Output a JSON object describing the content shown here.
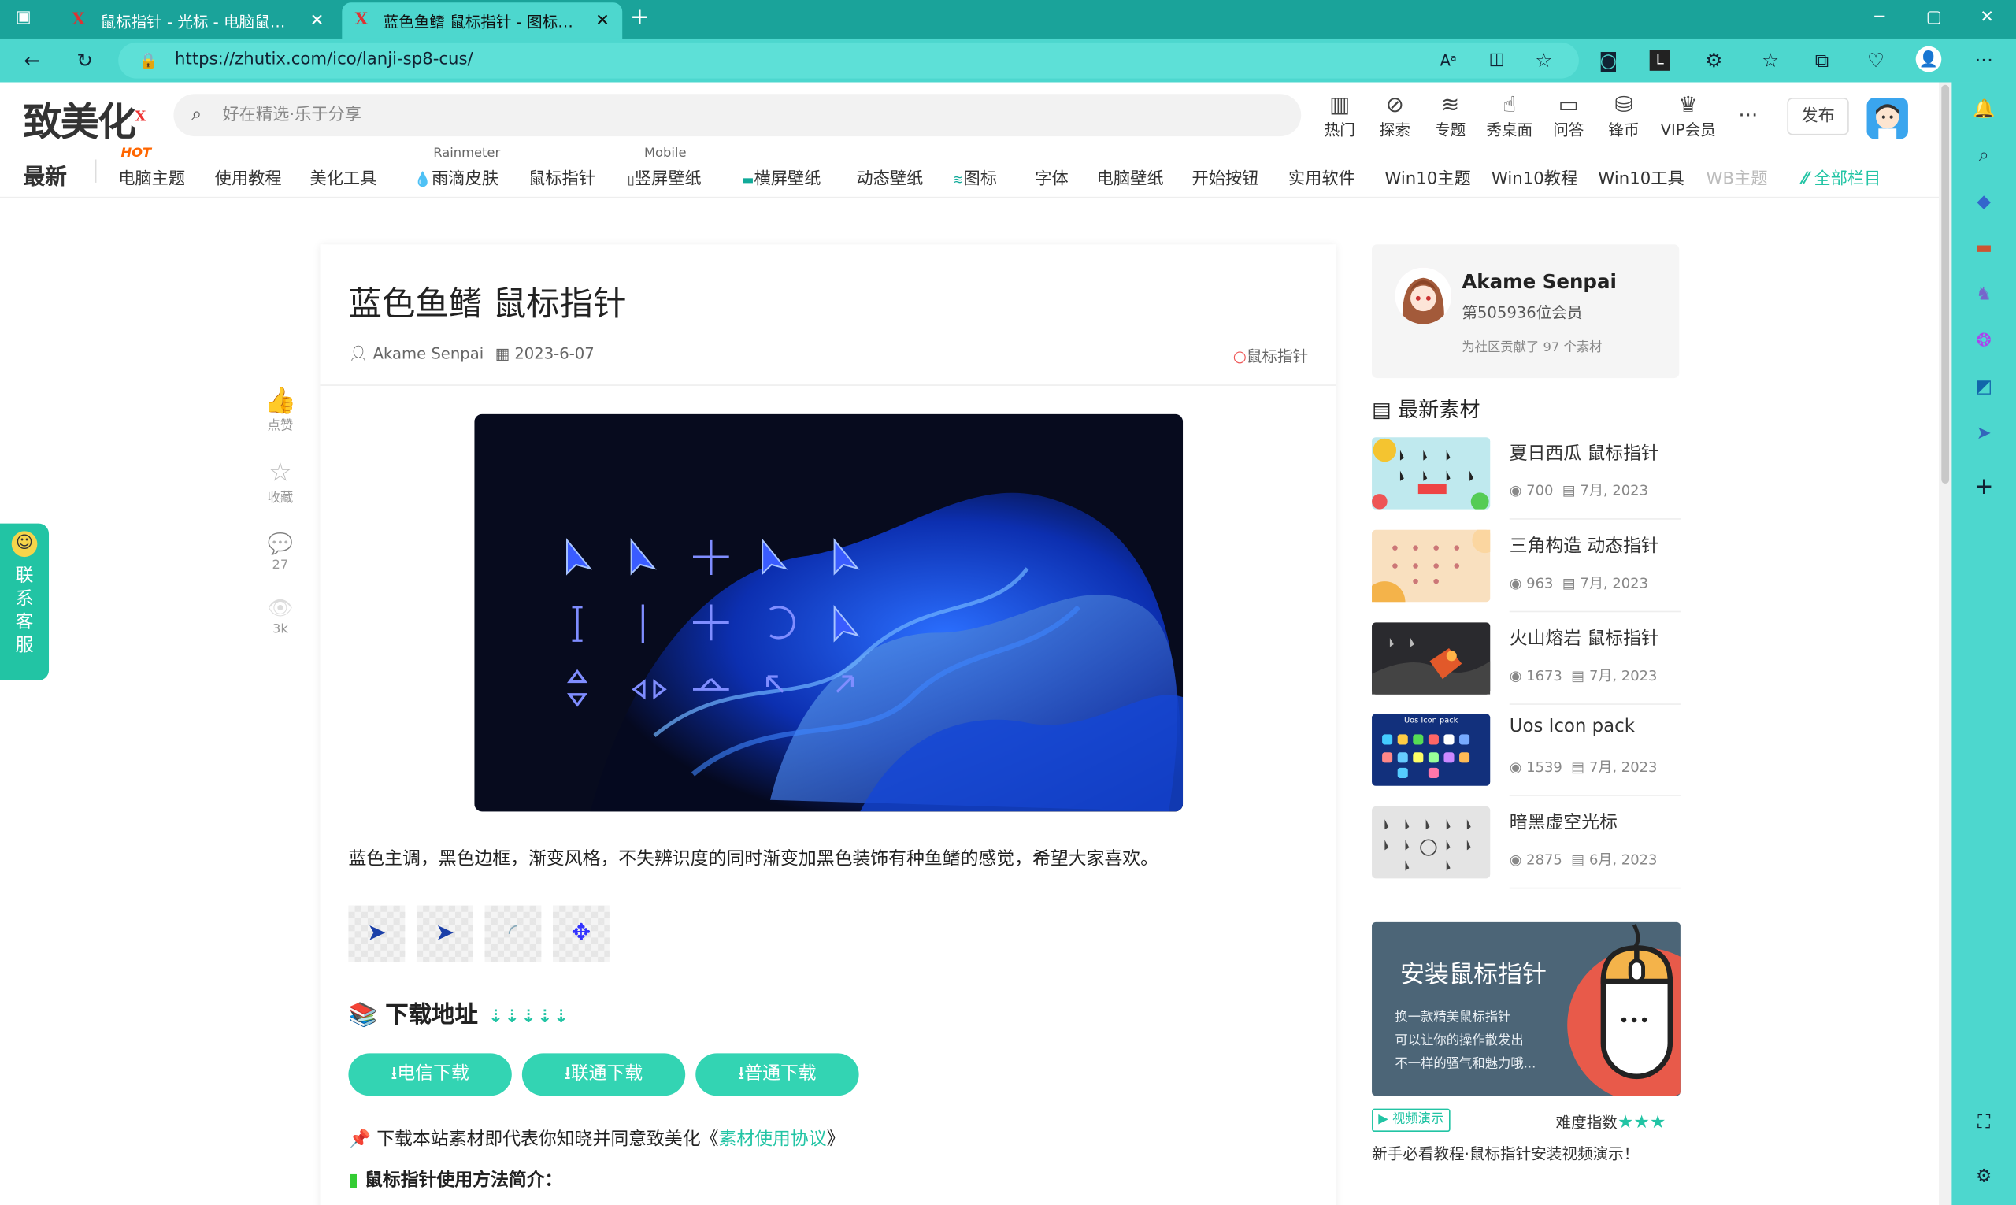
{
  "browser": {
    "tabs": [
      {
        "title": "鼠标指针 - 光标 - 电脑鼠标指针下载",
        "close": "✕",
        "active": false
      },
      {
        "title": "蓝色鱼鳍 鼠标指针 - 图标指针 - 致美化",
        "close": "✕",
        "active": true
      }
    ],
    "new_tab": "+",
    "url": "https://zhutix.com/ico/lanji-sp8-cus/",
    "win_min": "─",
    "win_max": "▢",
    "win_close": "✕"
  },
  "site": {
    "logo": "致美化",
    "logo_mark": "X",
    "search_placeholder": "好在精选·乐于分享",
    "top_nav": [
      {
        "label": "热门",
        "icon": "building-icon"
      },
      {
        "label": "探索",
        "icon": "compass-icon"
      },
      {
        "label": "专题",
        "icon": "layers-icon"
      },
      {
        "label": "秀桌面",
        "icon": "hand-icon"
      },
      {
        "label": "问答",
        "icon": "chat-icon"
      },
      {
        "label": "锋币",
        "icon": "coins-icon"
      },
      {
        "label": "VIP会员",
        "icon": "crown-icon"
      }
    ],
    "more": "···",
    "publish": "发布",
    "nav": {
      "latest": "最新",
      "hot_tag": "HOT",
      "theme": "电脑主题",
      "tutorial": "使用教程",
      "beautify": "美化工具",
      "rainmeter_small": "Rainmeter",
      "rainmeter": "雨滴皮肤",
      "cursor": "鼠标指针",
      "mobile_small": "Mobile",
      "vertical_wall": "竖屏壁纸",
      "horizontal_wall": "横屏壁纸",
      "dynamic_wall": "动态壁纸",
      "icons": "图标",
      "fonts": "字体",
      "pc_wall": "电脑壁纸",
      "start_btn": "开始按钮",
      "software": "实用软件",
      "win10_theme": "Win10主题",
      "win10_tut": "Win10教程",
      "win10_tool": "Win10工具",
      "wb_theme": "WB主题",
      "all_cols": "全部栏目"
    }
  },
  "left_actions": [
    {
      "icon": "thumbs-up-icon",
      "glyph": "👍",
      "label": "点赞"
    },
    {
      "icon": "star-icon",
      "glyph": "☆",
      "label": "收藏"
    },
    {
      "icon": "comment-icon",
      "glyph": "💬",
      "label": "27"
    },
    {
      "icon": "eye-icon",
      "glyph": "👁",
      "label": "3k"
    }
  ],
  "kefu": {
    "text": "联系客服"
  },
  "article": {
    "title": "蓝色鱼鳍 鼠标指针",
    "author": "Akame Senpai",
    "date": "2023-6-07",
    "category": "鼠标指针",
    "description": "蓝色主调，黑色边框，渐变风格，不失辨识度的同时渐变加黑色装饰有种鱼鳍的感觉，希望大家喜欢。",
    "download_title": "下载地址",
    "download_arrows": "⇣⇣⇣⇣⇣",
    "buttons": [
      "电信下载",
      "联通下载",
      "普通下载"
    ],
    "agree_prefix": "下载本站素材即代表你知晓并同意致美化《",
    "agree_link": "素材使用协议",
    "agree_suffix": "》",
    "usage_title": "鼠标指针使用方法简介："
  },
  "user": {
    "name": "Akame Senpai",
    "member": "第505936位会员",
    "contrib": "为社区贡献了 97 个素材"
  },
  "latest": {
    "title": "最新素材",
    "items": [
      {
        "title": "夏日西瓜 鼠标指针",
        "views": "700",
        "date": "7月, 2023"
      },
      {
        "title": "三角构造 动态指针",
        "views": "963",
        "date": "7月, 2023"
      },
      {
        "title": "火山熔岩 鼠标指针",
        "views": "1673",
        "date": "7月, 2023"
      },
      {
        "title": "Uos Icon pack",
        "views": "1539",
        "date": "7月, 2023",
        "thumb_text": "Uos Icon pack"
      },
      {
        "title": "暗黑虚空光标",
        "views": "2875",
        "date": "6月, 2023"
      }
    ]
  },
  "banner": {
    "title": "安装鼠标指针",
    "line1": "换一款精美鼠标指针",
    "line2": "可以让你的操作散发出",
    "line3": "不一样的骚气和魅力哦...",
    "video_tag": "视频演示",
    "difficulty": "难度指数",
    "stars": "★★★",
    "caption": "新手必看教程·鼠标指针安装视频演示！"
  },
  "colors": {
    "accent": "#22c4a4",
    "browser_frame": "#4dd7ce"
  }
}
